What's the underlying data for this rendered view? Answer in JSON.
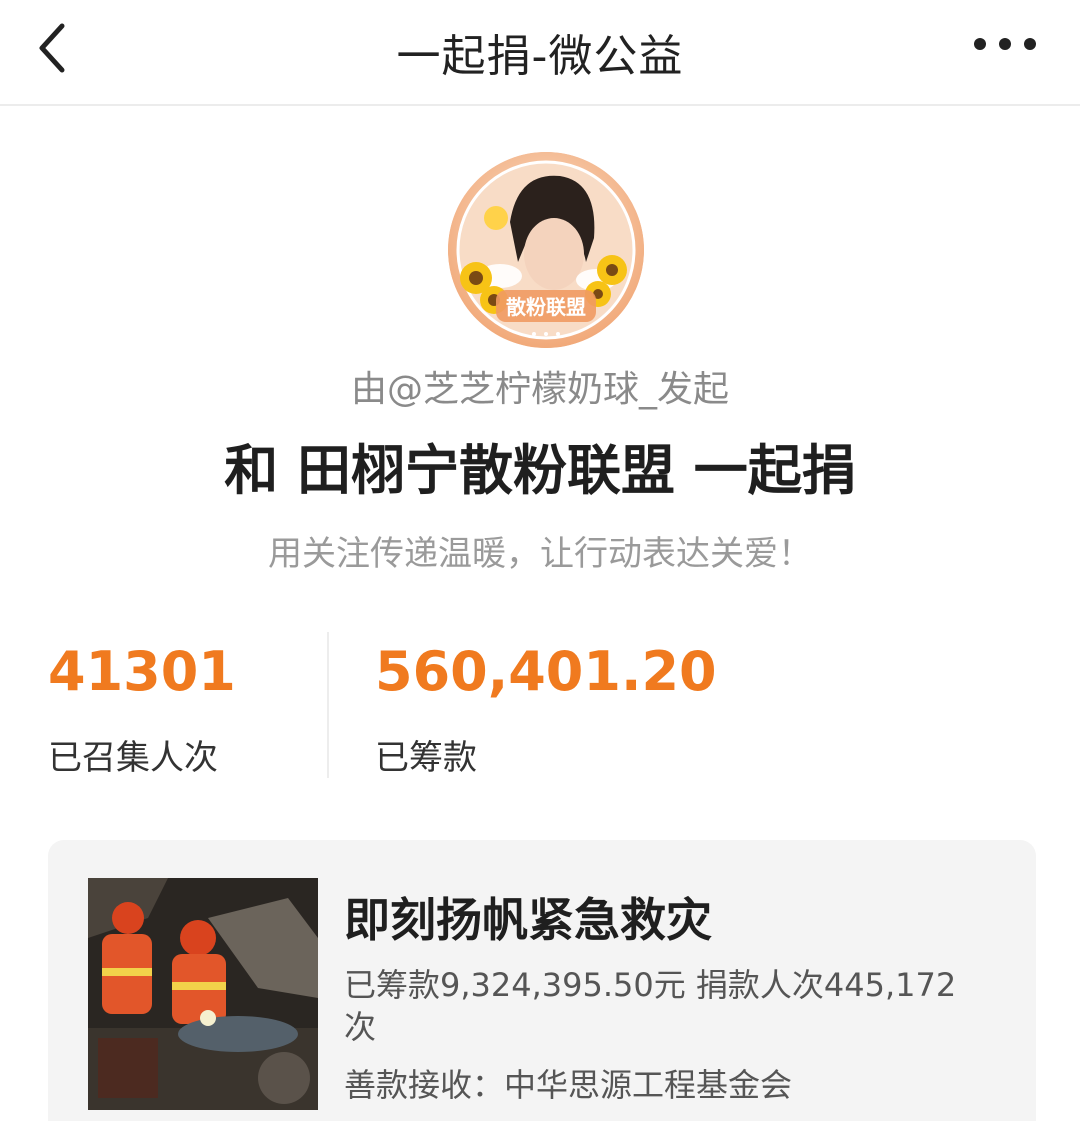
{
  "header": {
    "title": "一起捐-微公益",
    "back_icon": "chevron-left-icon",
    "more_icon": "more-horizontal-icon"
  },
  "profile": {
    "avatar_badge_text": "散粉联盟",
    "initiator_text": "由@芝芝柠檬奶球_发起",
    "title": "和 田栩宁散粉联盟 一起捐",
    "slogan": "用关注传递温暖，让行动表达关爱！"
  },
  "stats": {
    "participants_value": "41301",
    "participants_label": "已召集人次",
    "raised_value": "560,401.20",
    "raised_label": "已筹款"
  },
  "project": {
    "title": "即刻扬帆紧急救灾",
    "raised_text": "已筹款9,324,395.50元  捐款人次445,172次",
    "receiver_text": "善款接收：中华思源工程基金会"
  },
  "colors": {
    "accent": "#f07a1f",
    "card_bg": "#f4f4f4",
    "muted_text": "#8a8a8a"
  }
}
